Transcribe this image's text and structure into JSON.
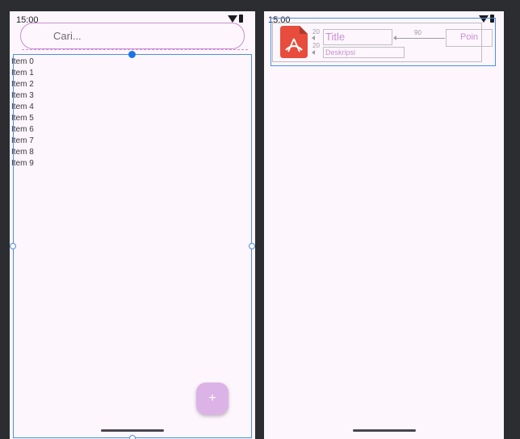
{
  "left_screen": {
    "status_time": "15:00",
    "search": {
      "placeholder": "Cari..."
    },
    "list_items": [
      "Item 0",
      "Item 1",
      "Item 2",
      "Item 3",
      "Item 4",
      "Item 5",
      "Item 6",
      "Item 7",
      "Item 8",
      "Item 9"
    ],
    "fab_label": "+"
  },
  "right_screen": {
    "status_time": "15:00",
    "card": {
      "title": "Title",
      "description": "Deskripsi",
      "poin": "Poin",
      "margin_label_top": "20",
      "margin_label_bottom": "20",
      "gap_label": "90"
    }
  },
  "colors": {
    "background": "#fdf6fd",
    "accent": "#c98fd1",
    "fab": "#dcb3e6",
    "selection": "#4a90e2",
    "icon_red": "#e74c3c"
  }
}
